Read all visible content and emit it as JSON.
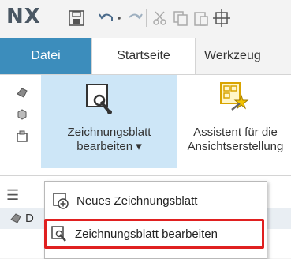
{
  "qat": {
    "logo": "NX"
  },
  "tabs": [
    {
      "label": "Datei"
    },
    {
      "label": "Startseite"
    },
    {
      "label": "Werkzeug"
    }
  ],
  "ribbon": {
    "drawing_sheet_button": {
      "line1": "Zeichnungsblatt",
      "line2": "bearbeiten",
      "dropdown_glyph": "▾"
    },
    "view_wizard_button": {
      "line1": "Assistent für die",
      "line2": "Ansichtserstellung"
    }
  },
  "resource_bar": {
    "row_label": "D"
  },
  "menu": {
    "items": [
      {
        "label": "Neues Zeichnungsblatt",
        "icon": "new-sheet-icon"
      },
      {
        "label": "Zeichnungsblatt bearbeiten",
        "icon": "edit-sheet-icon",
        "highlighted": true
      }
    ]
  },
  "colors": {
    "accent_tab": "#3c8dbc",
    "hover_fill": "#cde6f7",
    "highlight_border": "#e02020"
  }
}
